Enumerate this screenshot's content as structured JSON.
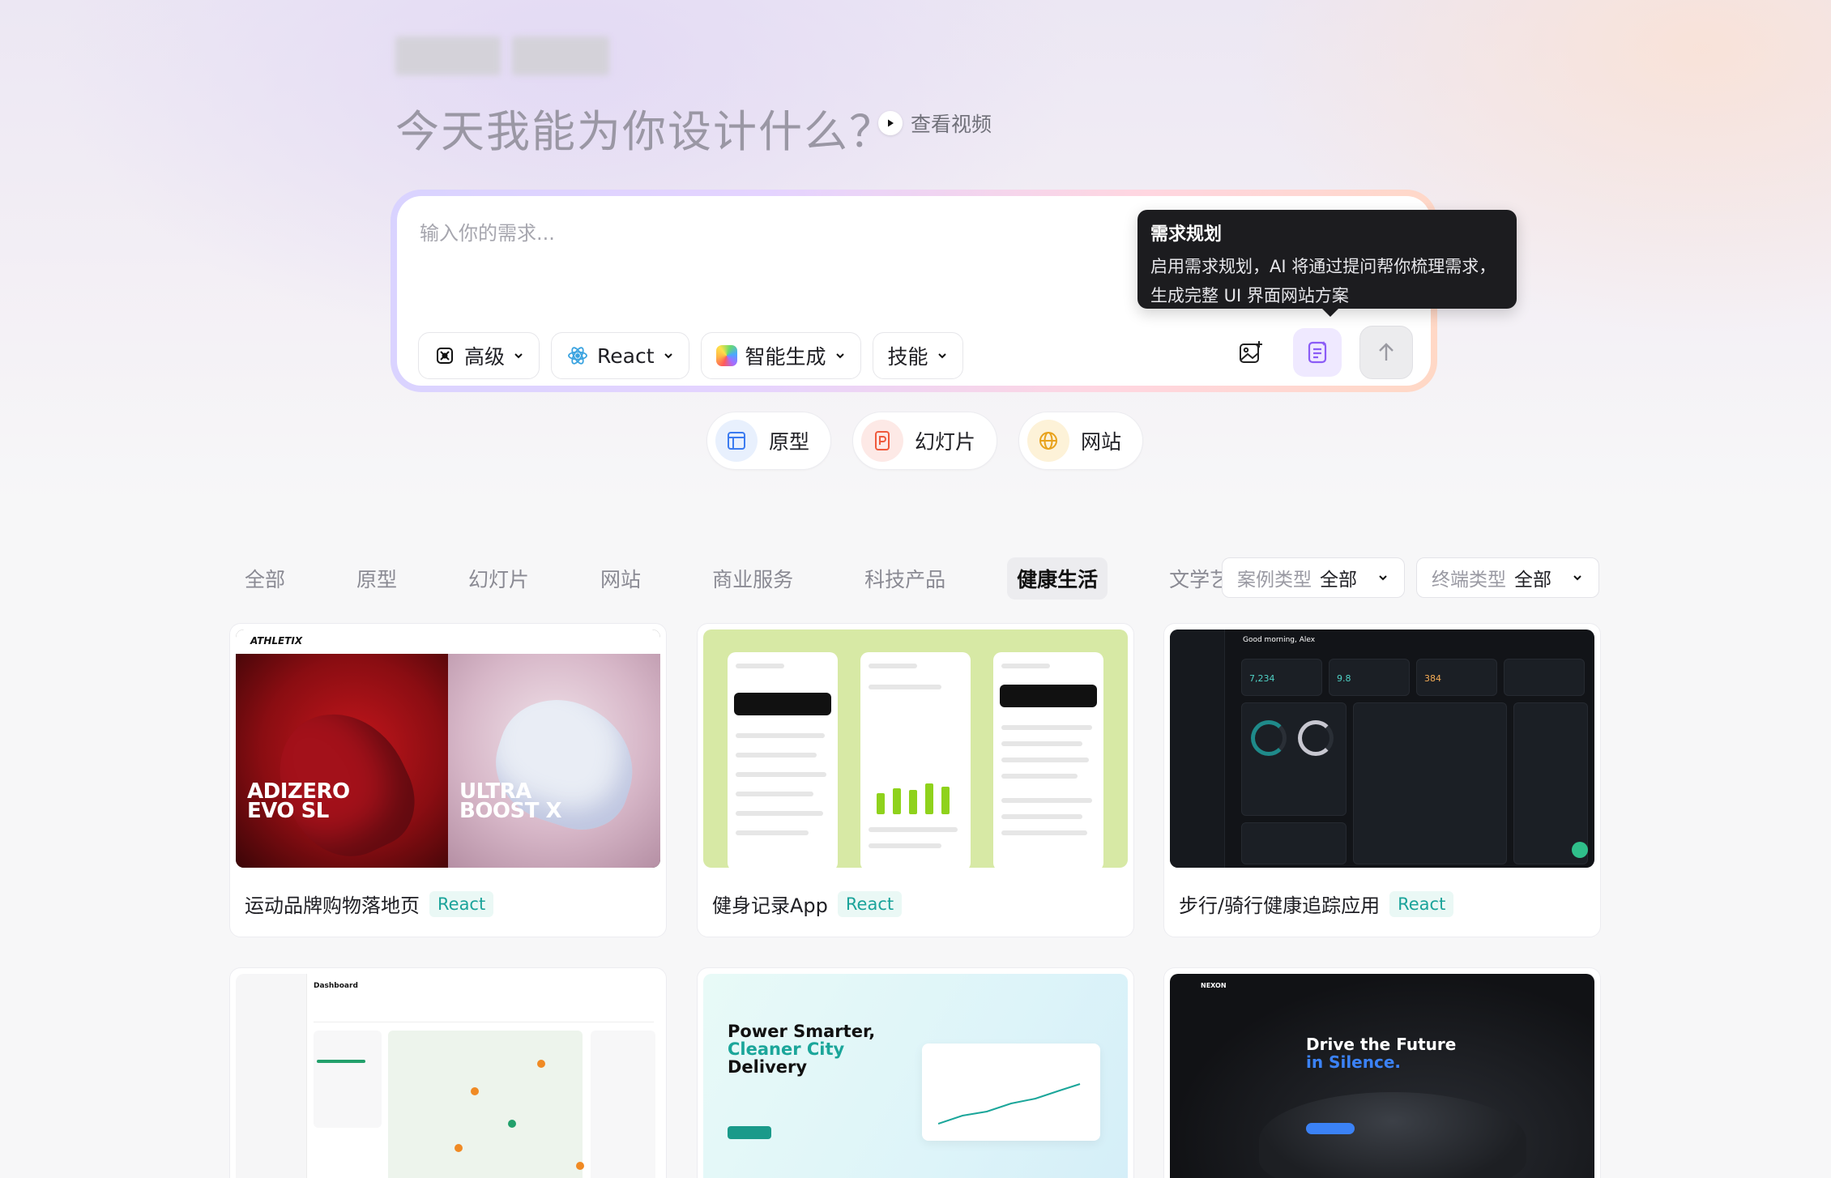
{
  "hero": {
    "headline": "今天我能为你设计什么？",
    "video_link": "查看视频"
  },
  "composer": {
    "placeholder": "输入你的需求...",
    "tools": [
      {
        "label": "高级"
      },
      {
        "label": "React"
      },
      {
        "label": "智能生成"
      },
      {
        "label": "技能"
      }
    ],
    "tooltip": {
      "title": "需求规划",
      "line1": "启用需求规划，AI 将通过提问帮你梳理需求，",
      "line2": "生成完整 UI 界面网站方案"
    }
  },
  "quick_types": [
    {
      "label": "原型"
    },
    {
      "label": "幻灯片"
    },
    {
      "label": "网站"
    }
  ],
  "filters": {
    "tabs": [
      "全部",
      "原型",
      "幻灯片",
      "网站",
      "商业服务",
      "科技产品",
      "健康生活",
      "文学艺术"
    ],
    "active_index": 6,
    "case_type": {
      "label": "案例类型",
      "value": "全部"
    },
    "device_type": {
      "label": "终端类型",
      "value": "全部"
    }
  },
  "cards": [
    {
      "title": "运动品牌购物落地页",
      "tag": "React",
      "thumb_brand": "ATHLETIX",
      "thumb_text_1": "ADIZERO\nEVO SL",
      "thumb_text_2": "ULTRA\nBOOST X"
    },
    {
      "title": "健身记录App",
      "tag": "React"
    },
    {
      "title": "步行/骑行健康追踪应用",
      "tag": "React",
      "thumb_greeting": "Good morning, Alex",
      "thumb_stat_1": "7,234",
      "thumb_stat_2": "9.8",
      "thumb_stat_3": "384"
    },
    {
      "title": "",
      "tag": "",
      "thumb_heading": "Dashboard"
    },
    {
      "title": "",
      "tag": "",
      "thumb_heading_1": "Power Smarter,",
      "thumb_heading_2": "Cleaner City",
      "thumb_heading_3": "Delivery"
    },
    {
      "title": "",
      "tag": "",
      "thumb_brand": "NEXON",
      "thumb_heading_1": "Drive the Future",
      "thumb_heading_2": "in Silence."
    }
  ],
  "colors": {
    "accent_teal": "#1aa39a",
    "plan_purple": "#8b5cf6",
    "tooltip_bg": "#1c1c1f"
  }
}
